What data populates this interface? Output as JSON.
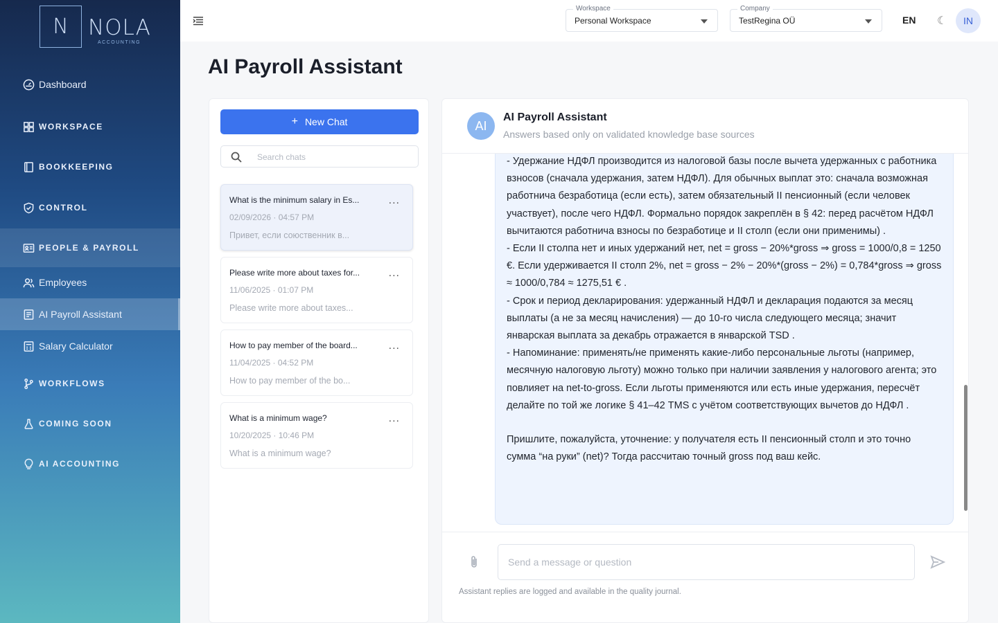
{
  "brand": {
    "mark": "N",
    "name": "NOLA",
    "sub": "ACCOUNTING"
  },
  "sidebar": {
    "dashboard": "Dashboard",
    "workspace": "WORKSPACE",
    "bookkeeping": "BOOKKEEPING",
    "control": "CONTROL",
    "people_payroll": "PEOPLE & PAYROLL",
    "employees": "Employees",
    "ai_payroll_assistant": "AI Payroll Assistant",
    "salary_calculator": "Salary Calculator",
    "workflows": "WORKFLOWS",
    "coming_soon": "COMING SOON",
    "ai_accounting": "AI ACCOUNTING"
  },
  "topbar": {
    "workspace_label": "Workspace",
    "workspace_value": "Personal Workspace",
    "company_label": "Company",
    "company_value": "TestRegina OÜ",
    "language": "EN",
    "theme_glyph": "☾",
    "user_initials": "IN"
  },
  "page": {
    "title": "AI Payroll Assistant"
  },
  "chats": {
    "new_chat_label": "New Chat",
    "search_placeholder": "Search chats",
    "items": [
      {
        "title": "What is the minimum salary in Es...",
        "date": "02/09/2026 · 04:57 PM",
        "preview": "Привет, если союственник в...",
        "more": "..."
      },
      {
        "title": "Please write more about taxes for...",
        "date": "11/06/2025 · 01:07 PM",
        "preview": "Please write more about taxes...",
        "more": "..."
      },
      {
        "title": "How to pay member of the board...",
        "date": "11/04/2025 · 04:52 PM",
        "preview": "How to pay member of the bo...",
        "more": "..."
      },
      {
        "title": "What is a minimum wage?",
        "date": "10/20/2025 · 10:46 PM",
        "preview": "What is a minimum wage?",
        "more": "..."
      }
    ]
  },
  "chat": {
    "avatar": "AI",
    "title": "AI Payroll Assistant",
    "subtitle": "Answers based only on validated knowledge base sources",
    "message_paragraph_1": "- Удержание НДФЛ производится из налоговой базы после вычета удержанных с работника взносов (сначала удержания, затем НДФЛ). Для обычных выплат это: сначала возможная работнича безработица (если есть), затем обязательный II пенсионный (если человек участвует), после чего НДФЛ. Формально порядок закреплён в § 42: перед расчётом НДФЛ вычитаются работнича взносы по безработице и II столп (если они применимы) .",
    "message_paragraph_2": "- Если II столпа нет и иных удержаний нет, net = gross − 20%*gross ⇒ gross = 1000/0,8 = 1250 €. Если удерживается II столп 2%, net = gross − 2% − 20%*(gross − 2%) = 0,784*gross ⇒ gross ≈ 1000/0,784 ≈ 1275,51 € .",
    "message_paragraph_3": "- Срок и период декларирования: удержанный НДФЛ и декларация подаются за месяц выплаты (а не за месяц начисления) — до 10-го числа следующего месяца; значит январская выплата за декабрь отражается в январской TSD .",
    "message_paragraph_4": "- Напоминание: применять/не применять какие-либо персональные льготы (например, месячную налоговую льготу) можно только при наличии заявления у налогового агента; это повлияет на net-to-gross. Если льготы применяются или есть иные удержания, пересчёт делайте по той же логике § 41–42 TMS с учётом соответствующих вычетов до НДФЛ .",
    "message_paragraph_5": "Пришлите, пожалуйста, уточнение: у получателя есть II пенсионный столп и это точно сумма “на руки” (net)? Тогда рассчитаю точный gross под ваш кейс.",
    "input_placeholder": "Send a message or question",
    "footnote": "Assistant replies are logged and available in the quality journal."
  },
  "colors": {
    "primary": "#3b73ee",
    "sidebar_top": "#16294d",
    "sidebar_bottom": "#5cb8c0",
    "bubble": "#eef4fe"
  }
}
